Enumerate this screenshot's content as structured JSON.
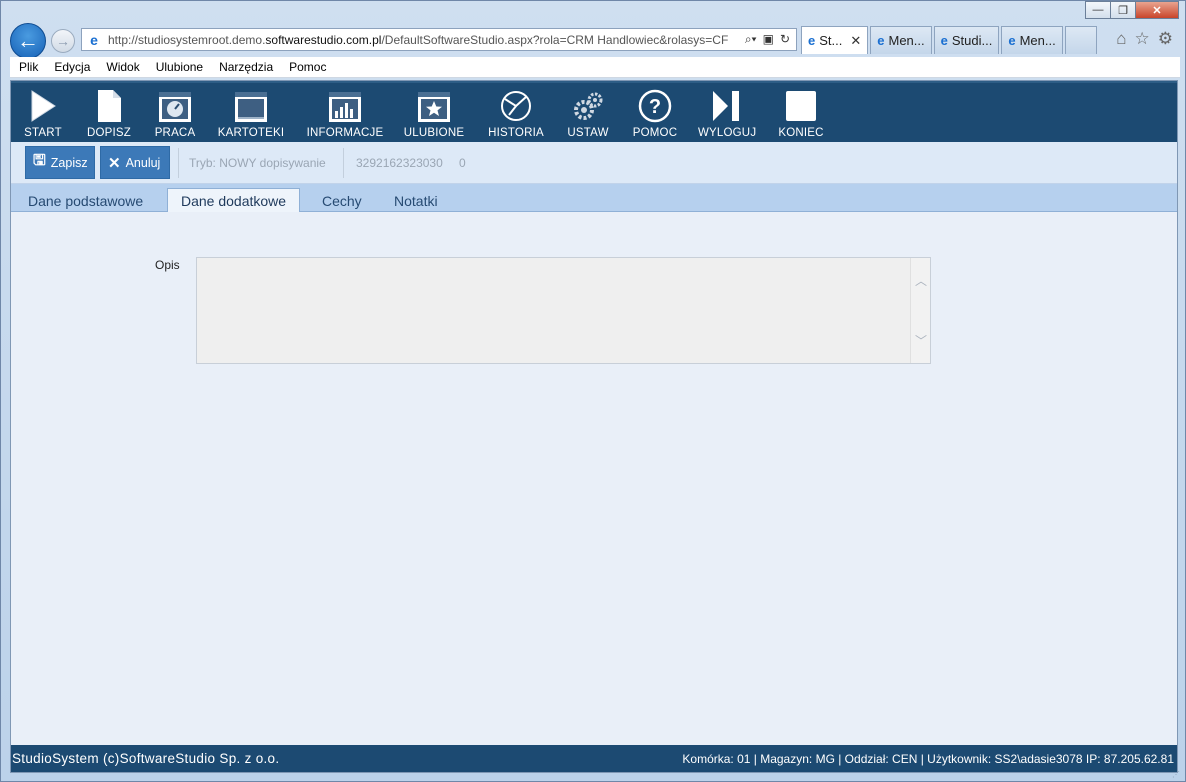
{
  "browser": {
    "url_prefix": "http://studiosystemroot.demo.",
    "url_domain": "softwarestudio.com.pl",
    "url_suffix": "/DefaultSoftwareStudio.aspx?rola=CRM Handlowiec&rolasys=CF",
    "tabs": [
      {
        "label": "St...",
        "active": true
      },
      {
        "label": "Men..."
      },
      {
        "label": "Studi..."
      },
      {
        "label": "Men..."
      }
    ],
    "menu": [
      "Plik",
      "Edycja",
      "Widok",
      "Ulubione",
      "Narzędzia",
      "Pomoc"
    ],
    "window_buttons": {
      "minimize": "—",
      "restore": "❐",
      "close": "✕"
    }
  },
  "toolbar": {
    "items": [
      {
        "label": "START",
        "icon": "play-icon"
      },
      {
        "label": "DOPISZ",
        "icon": "document-icon"
      },
      {
        "label": "PRACA",
        "icon": "gauge-icon"
      },
      {
        "label": "KARTOTEKI",
        "icon": "window-icon"
      },
      {
        "label": "INFORMACJE",
        "icon": "bar-chart-icon"
      },
      {
        "label": "ULUBIONE",
        "icon": "star-icon"
      },
      {
        "label": "HISTORIA",
        "icon": "history-icon"
      },
      {
        "label": "USTAW",
        "icon": "gears-icon"
      },
      {
        "label": "POMOC",
        "icon": "help-icon"
      },
      {
        "label": "WYLOGUJ",
        "icon": "logout-icon"
      },
      {
        "label": "KONIEC",
        "icon": "stop-icon"
      }
    ]
  },
  "actions": {
    "save": "Zapisz",
    "cancel": "Anuluj",
    "mode": "Tryb: NOWY dopisywanie",
    "record_id": "3292162323030",
    "record_num": "0"
  },
  "form_tabs": [
    "Dane podstawowe",
    "Dane dodatkowe",
    "Cechy",
    "Notatki"
  ],
  "form": {
    "opis_label": "Opis",
    "opis_value": ""
  },
  "status": {
    "left": "StudioSystem (c)SoftwareStudio Sp. z o.o.",
    "right": "Komórka: 01 | Magazyn: MG | Oddział: CEN | Użytkownik: SS2\\adasie3078 IP: 87.205.62.81"
  }
}
